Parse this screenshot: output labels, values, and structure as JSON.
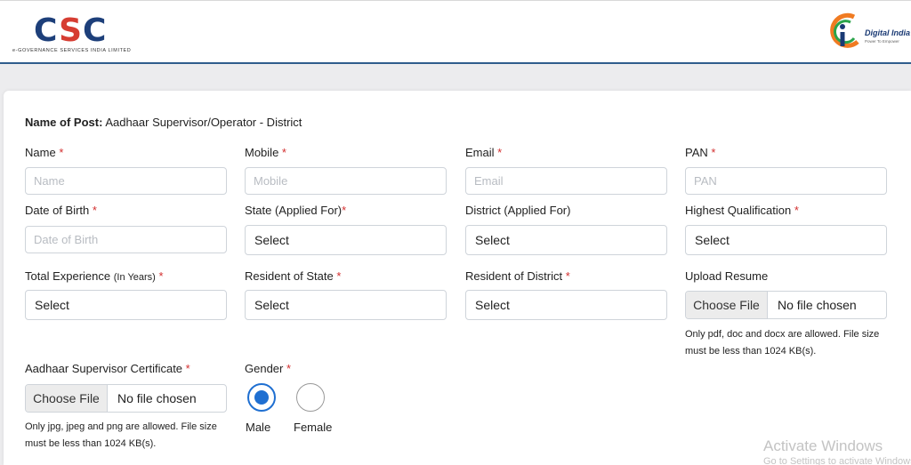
{
  "header": {
    "csc_letters": [
      "C",
      "S",
      "C"
    ],
    "csc_subtitle": "e-GOVERNANCE SERVICES INDIA LIMITED",
    "di_title": "Digital India",
    "di_tagline": "Power To Empower"
  },
  "post": {
    "label": "Name of Post:",
    "value": "Aadhaar Supervisor/Operator - District"
  },
  "fields": {
    "name": {
      "label": "Name",
      "required": "*",
      "placeholder": "Name"
    },
    "mobile": {
      "label": "Mobile",
      "required": "*",
      "placeholder": "Mobile"
    },
    "email": {
      "label": "Email",
      "required": "*",
      "placeholder": "Email"
    },
    "pan": {
      "label": "PAN",
      "required": "*",
      "placeholder": "PAN"
    },
    "dob": {
      "label": "Date of Birth",
      "required": "*",
      "placeholder": "Date of Birth"
    },
    "state_applied": {
      "label": "State (Applied For)",
      "required": "*",
      "value": "Select"
    },
    "district_applied": {
      "label": "District (Applied For)",
      "value": "Select"
    },
    "qualification": {
      "label": "Highest Qualification",
      "required": "*",
      "value": "Select"
    },
    "experience": {
      "label": "Total Experience",
      "label_small": "(In Years)",
      "required": "*",
      "value": "Select"
    },
    "resident_state": {
      "label": "Resident of State",
      "required": "*",
      "value": "Select"
    },
    "resident_district": {
      "label": "Resident of District",
      "required": "*",
      "value": "Select"
    },
    "resume": {
      "label": "Upload Resume",
      "button": "Choose File",
      "status": "No file chosen",
      "note_line1": "Only pdf, doc and docx are allowed. File size",
      "note_line2": "must be less than 1024 KB(s)."
    },
    "certificate": {
      "label": "Aadhaar Supervisor Certificate",
      "required": "*",
      "button": "Choose File",
      "status": "No file chosen",
      "note_line1": "Only jpg, jpeg and png are allowed. File size",
      "note_line2": "must be less than 1024 KB(s)."
    },
    "gender": {
      "label": "Gender",
      "required": "*",
      "options": [
        "Male",
        "Female"
      ],
      "selected": "Male"
    }
  },
  "watermark": {
    "title": "Activate Windows",
    "subtitle": "Go to Settings to activate Windows."
  },
  "colors": {
    "accent": "#1f6fd1",
    "required": "#d32f2f",
    "header_rule": "#2f5d8c",
    "csc_blue": "#1d3f7a",
    "csc_red": "#d63d32"
  }
}
